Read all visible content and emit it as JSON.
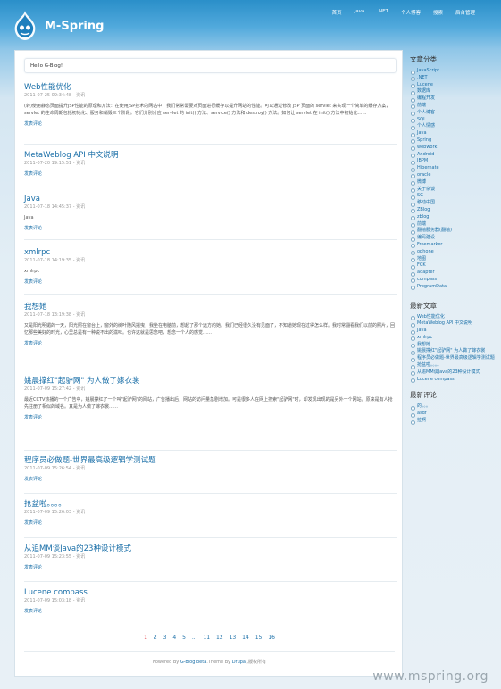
{
  "site": {
    "title": "M-Spring",
    "nav": [
      "首页",
      "Java",
      ".NET",
      "个人博客",
      "搜索",
      "后台管理"
    ]
  },
  "hello": "Hello G-Blog!",
  "posts": [
    {
      "title": "Web性能优化",
      "meta": "2011-07-25 09:34:48 - 资讯",
      "body": "(转)使用静态页面提升JSP性能的原理和方法：在使用JSP技术的网站中，我们常常需要对页面进行缓存以提升网站的性能。可以通过修改 JSP 页面的 servlet 来实现一个简单的缓存方案，servlet 的生命周期包括初始化、服务和销毁三个阶段。它们分别对应 servlet 的 init() 方法、service() 方法和 destroy() 方法。如何让 servlet 在 init() 方法中初始化……",
      "comment": "发表评论"
    },
    {
      "title": "MetaWeblog API 中文说明",
      "meta": "2011-07-20 19:15:51 - 资讯",
      "body": "",
      "comment": "发表评论"
    },
    {
      "title": "Java",
      "meta": "2011-07-18 14:45:37 - 资讯",
      "body": "Java",
      "comment": "发表评论"
    },
    {
      "title": "xmlrpc",
      "meta": "2011-07-18 14:19:35 - 资讯",
      "body": "xmlrpc",
      "comment": "发表评论"
    },
    {
      "title": "我想她",
      "meta": "2011-07-18 13:19:38 - 资讯",
      "body": "又是阳光明媚的一天，阳光照在窗台上，窗外的树叶随风摇曳，我坐在电脑前，想起了那个远方的她。我们已经很久没有见面了，不知道她现在过得怎么样。我时常翻看我们以前的照片，回忆那些美好的时光，心里总是有一种说不出的滋味。也许这就是思念吧，想念一个人的感觉……",
      "comment": "发表评论"
    },
    {
      "title": "姚晨撑红\"起驴网\" 为人做了嫁衣裳",
      "meta": "2011-07-09 15:27:42 - 资讯",
      "body": "最近CCTV热播的一个广告中，姚晨撑红了一个叫\"起驴网\"的网站，广告播出后，网站的访问量急剧增加。可是很多人在网上搜索\"起驴网\"时，却发现出现的是另外一个网站，原来是有人抢先注册了相似的域名。真是为人做了嫁衣裳……",
      "comment": "发表评论"
    },
    {
      "title": "程序员必做题-世界最高级逻辑学测试题",
      "meta": "2011-07-09 15:26:54 - 资讯",
      "body": "",
      "comment": "发表评论"
    },
    {
      "title": "抢盆啦。。。。",
      "meta": "2011-07-09 15:26:03 - 资讯",
      "body": "",
      "comment": "发表评论"
    },
    {
      "title": "从追MM谈Java的23种设计模式",
      "meta": "2011-07-09 15:23:55 - 资讯",
      "body": "",
      "comment": "发表评论"
    },
    {
      "title": "Lucene compass",
      "meta": "2011-07-09 15:03:18 - 资讯",
      "body": "",
      "comment": "发表评论"
    }
  ],
  "pagination": {
    "current": "1",
    "pages": [
      "2",
      "3",
      "4",
      "5",
      "...",
      "11",
      "12",
      "13",
      "14",
      "15",
      "16"
    ]
  },
  "footer": {
    "prefix": "Powered By",
    "gblog": "G-Blog beta",
    "theme": ".Theme By",
    "drupal": "Drupal",
    "suffix": ",版权所有"
  },
  "sidebar": {
    "categories_title": "文章分类",
    "categories": [
      "JavaScript",
      ".NET",
      "Lucene",
      "数据库",
      "编程开发",
      "前端",
      "个人博客",
      "SQL",
      "个人情感",
      "Java",
      "Spring",
      "webwork",
      "Android",
      "JBPM",
      "Hibernate",
      "oracle",
      "微博",
      "关于杂谈",
      "SG",
      "移动中国",
      "ZBlog",
      "zblog",
      "前端",
      "翻墙服务器(翻墙)",
      "编码建设",
      "Freemarker",
      "ophone",
      "地图",
      "FCK",
      "adapter",
      "compass",
      "ProgramData"
    ],
    "recent_title": "最新文章",
    "recent": [
      "Web性能优化",
      "MetaWeblog API 中文说明",
      "Java",
      "xmlrpc",
      "我想她",
      "姚晨撑红\"起驴网\" 为人做了嫁衣裳",
      "程序员必做题-世界最高级逻辑学测试题",
      "抢盆啦。。。。",
      "从追MM谈Java的23种设计模式",
      "Lucene compass"
    ],
    "comments_title": "最新评论",
    "comments": [
      "的。。。",
      "asdf",
      "拉啊"
    ]
  },
  "watermark": "www.mspring.org"
}
